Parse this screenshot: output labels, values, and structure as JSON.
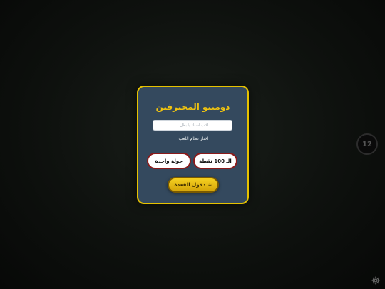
{
  "game": {
    "title": "دومينو المحترفين",
    "name_placeholder": "اكتب اسمك يا بطل...",
    "mode_label": "اختار نظام اللعب:",
    "modes": [
      {
        "label": "الـ 100 نقطة"
      },
      {
        "label": "جولة واحدة"
      }
    ],
    "enter_label": "دخول القعدة",
    "enter_icon": "☕",
    "timer_value": "12"
  },
  "icons": {
    "cup": "coffee-cup-icon",
    "settings": "gear-icon"
  },
  "colors": {
    "panel": "#34495e",
    "border_gold": "#e6c200",
    "title_gold": "#f1c40f",
    "button_border": "#8b1a1a",
    "enter_gold": "#f5d020",
    "background": "#0e110e"
  }
}
